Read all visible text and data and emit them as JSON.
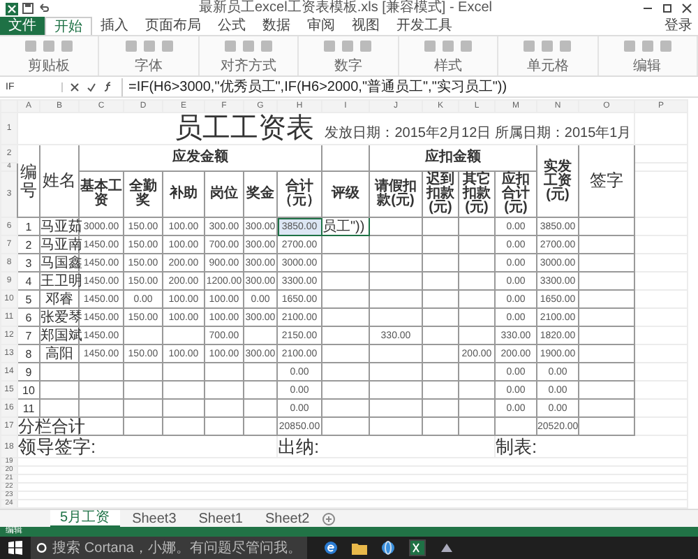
{
  "window": {
    "title": "最新员工excel工资表模板.xls [兼容模式] - Excel"
  },
  "ribbon": {
    "tabs": [
      {
        "label": "文件",
        "selected": false
      },
      {
        "label": "开始",
        "selected": true
      },
      {
        "label": "插入",
        "selected": false
      },
      {
        "label": "页面布局",
        "selected": false
      },
      {
        "label": "公式",
        "selected": false
      },
      {
        "label": "数据",
        "selected": false
      },
      {
        "label": "审阅",
        "selected": false
      },
      {
        "label": "视图",
        "selected": false
      },
      {
        "label": "开发工具",
        "selected": false
      }
    ],
    "account_label": "登录",
    "groups": [
      "剪贴板",
      "字体",
      "对齐方式",
      "数字",
      "样式",
      "单元格",
      "编辑"
    ]
  },
  "formula_bar": {
    "name_box": "IF",
    "formula": "=IF(H6>3000,\"优秀员工\",IF(H6>2000,\"普通员工\",\"实习员工\"))"
  },
  "sheet": {
    "columns": [
      "A",
      "B",
      "C",
      "D",
      "E",
      "F",
      "G",
      "H",
      "I",
      "J",
      "K",
      "L",
      "M",
      "N",
      "O",
      "P"
    ],
    "title": "员工工资表",
    "date_note": "发放日期：2015年2月12日 所属日期：2015年1月",
    "header_row_numbers": [
      "1",
      "2",
      "4",
      "3"
    ],
    "headers": {
      "number": "编号",
      "name": "姓名",
      "payable": "应发金额",
      "payable_items": [
        "基本工资",
        "全勤奖",
        "补助",
        "岗位",
        "奖金",
        "合计（元）"
      ],
      "rating": "评级",
      "deduct": "应扣金额",
      "deduct_items": [
        "请假扣款(元)",
        "迟到扣款(元)",
        "其它扣款(元)",
        "应扣合计(元)"
      ],
      "net": "实发工资(元)",
      "sign": "签字"
    },
    "rows": [
      {
        "row_number": "6",
        "no": "1",
        "name": "马亚茹",
        "total_selected": true,
        "rating_editing": true,
        "cells": {
          "C": "3000.00",
          "D": "150.00",
          "E": "100.00",
          "F": "300.00",
          "G": "300.00",
          "H": "3850.00",
          "I": "员工\"))",
          "M": "0.00",
          "N": "3850.00"
        }
      },
      {
        "row_number": "7",
        "no": "2",
        "name": "马亚南",
        "cells": {
          "C": "1450.00",
          "D": "150.00",
          "E": "100.00",
          "F": "700.00",
          "G": "300.00",
          "H": "2700.00",
          "M": "0.00",
          "N": "2700.00"
        }
      },
      {
        "row_number": "8",
        "no": "3",
        "name": "马国鑫",
        "cells": {
          "C": "1450.00",
          "D": "150.00",
          "E": "200.00",
          "F": "900.00",
          "G": "300.00",
          "H": "3000.00",
          "M": "0.00",
          "N": "3000.00"
        }
      },
      {
        "row_number": "9",
        "no": "4",
        "name": "王卫明",
        "cells": {
          "C": "1450.00",
          "D": "150.00",
          "E": "200.00",
          "F": "1200.00",
          "G": "300.00",
          "H": "3300.00",
          "M": "0.00",
          "N": "3300.00"
        }
      },
      {
        "row_number": "10",
        "no": "5",
        "name": "邓睿",
        "cells": {
          "C": "1450.00",
          "D": "0.00",
          "E": "100.00",
          "F": "100.00",
          "G": "0.00",
          "H": "1650.00",
          "M": "0.00",
          "N": "1650.00"
        }
      },
      {
        "row_number": "11",
        "no": "6",
        "name": "张爱琴",
        "cells": {
          "C": "1450.00",
          "D": "150.00",
          "E": "100.00",
          "F": "100.00",
          "G": "300.00",
          "H": "2100.00",
          "M": "0.00",
          "N": "2100.00"
        }
      },
      {
        "row_number": "12",
        "no": "7",
        "name": "郑国斌",
        "cells": {
          "C": "1450.00",
          "F": "700.00",
          "H": "2150.00",
          "J": "330.00",
          "M": "330.00",
          "N": "1820.00"
        }
      },
      {
        "row_number": "13",
        "no": "8",
        "name": "高阳",
        "cells": {
          "C": "1450.00",
          "D": "150.00",
          "E": "100.00",
          "F": "100.00",
          "G": "300.00",
          "H": "2100.00",
          "L": "200.00",
          "M": "200.00",
          "N": "1900.00"
        }
      },
      {
        "row_number": "14",
        "no": "9",
        "cells": {
          "H": "0.00",
          "M": "0.00",
          "N": "0.00"
        }
      },
      {
        "row_number": "15",
        "no": "10",
        "cells": {
          "H": "0.00",
          "M": "0.00",
          "N": "0.00"
        }
      },
      {
        "row_number": "16",
        "no": "11",
        "cells": {
          "H": "0.00",
          "M": "0.00",
          "N": "0.00"
        }
      }
    ],
    "total_row": {
      "row_number": "17",
      "label": "分栏合计",
      "cells": {
        "H": "20850.00",
        "N": "20520.00"
      }
    },
    "footer": {
      "row_number": "18",
      "items": [
        "领导签字:",
        "出纳:",
        "制表:"
      ]
    },
    "empty_row_numbers": [
      "19",
      "20",
      "21",
      "22",
      "23",
      "24"
    ]
  },
  "sheet_tabs": [
    {
      "label": "5月工资",
      "selected": true
    },
    {
      "label": "Sheet3",
      "selected": false
    },
    {
      "label": "Sheet1",
      "selected": false
    },
    {
      "label": "Sheet2",
      "selected": false
    }
  ],
  "status_bar": {
    "mode": "编辑"
  },
  "taskbar": {
    "search_placeholder": "搜索 Cortana，小娜。有问题尽管问我。"
  }
}
